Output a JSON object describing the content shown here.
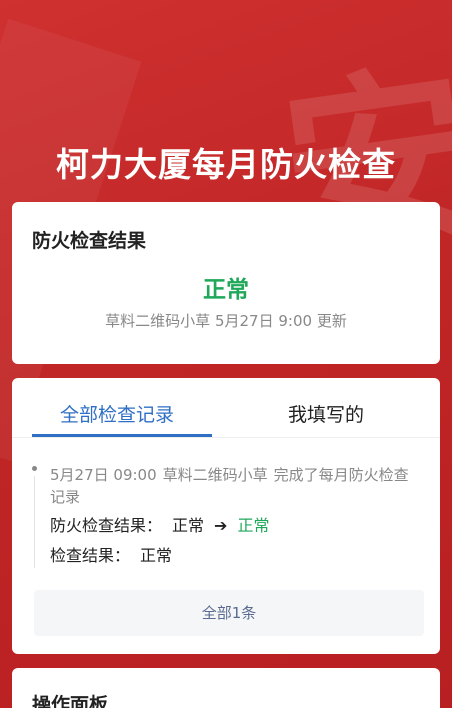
{
  "header": {
    "title": "柯力大厦每月防火检查",
    "bg_glyph": "安"
  },
  "result_card": {
    "title": "防火检查结果",
    "status": "正常",
    "status_color": "#1fa85a",
    "updater": "草料二维码小草",
    "updated_time": "5月27日 9:00",
    "updated_suffix": "更新"
  },
  "records_card": {
    "tabs": [
      {
        "label": "全部检查记录",
        "active": true
      },
      {
        "label": "我填写的",
        "active": false
      }
    ],
    "records": [
      {
        "time": "5月27日 09:00",
        "user": "草料二维码小草",
        "action": "完成了每月防火检查记录",
        "fields": [
          {
            "key": "防火检查结果：",
            "old": "正常",
            "new": "正常"
          },
          {
            "key": "检查结果：",
            "value": "正常"
          }
        ]
      }
    ],
    "all_button": "全部1条"
  },
  "ops_card": {
    "title": "操作面板"
  },
  "colors": {
    "brand_red": "#c62a2a",
    "accent_blue": "#2f6fc5",
    "success_green": "#1fa85a"
  }
}
